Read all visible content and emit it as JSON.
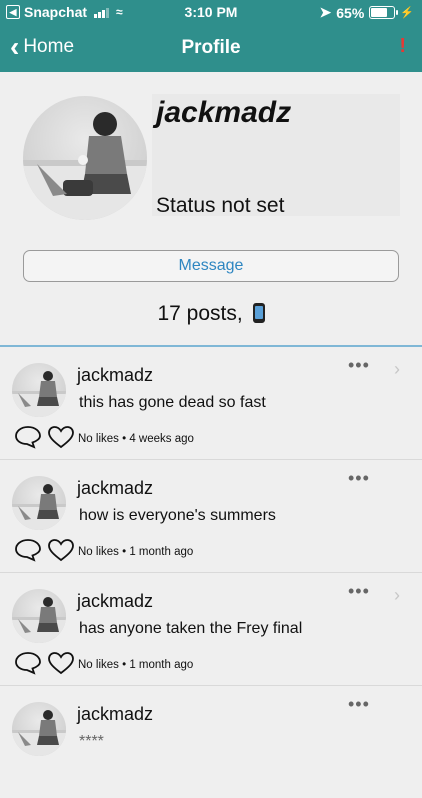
{
  "statusbar": {
    "carrier": "Snapchat",
    "time": "3:10 PM",
    "battery": "65%",
    "battery_level": 0.65
  },
  "nav": {
    "back_label": "Home",
    "title": "Profile",
    "alert": "!"
  },
  "profile": {
    "username": "jackmadz",
    "status": "Status not set",
    "message_button": "Message",
    "posts_count": "17 posts,"
  },
  "posts": [
    {
      "name": "jackmadz",
      "text": "this has gone dead so fast",
      "meta": "No likes • 4 weeks ago"
    },
    {
      "name": "jackmadz",
      "text": "how is everyone's summers",
      "meta": "No likes • 1 month ago"
    },
    {
      "name": "jackmadz",
      "text": "has anyone taken the Frey final",
      "meta": "No likes • 1 month ago"
    },
    {
      "name": "jackmadz",
      "text": "****",
      "meta": ""
    }
  ],
  "colors": {
    "header": "#2f8f8c",
    "link": "#2e86c1",
    "alert": "#e53935"
  }
}
